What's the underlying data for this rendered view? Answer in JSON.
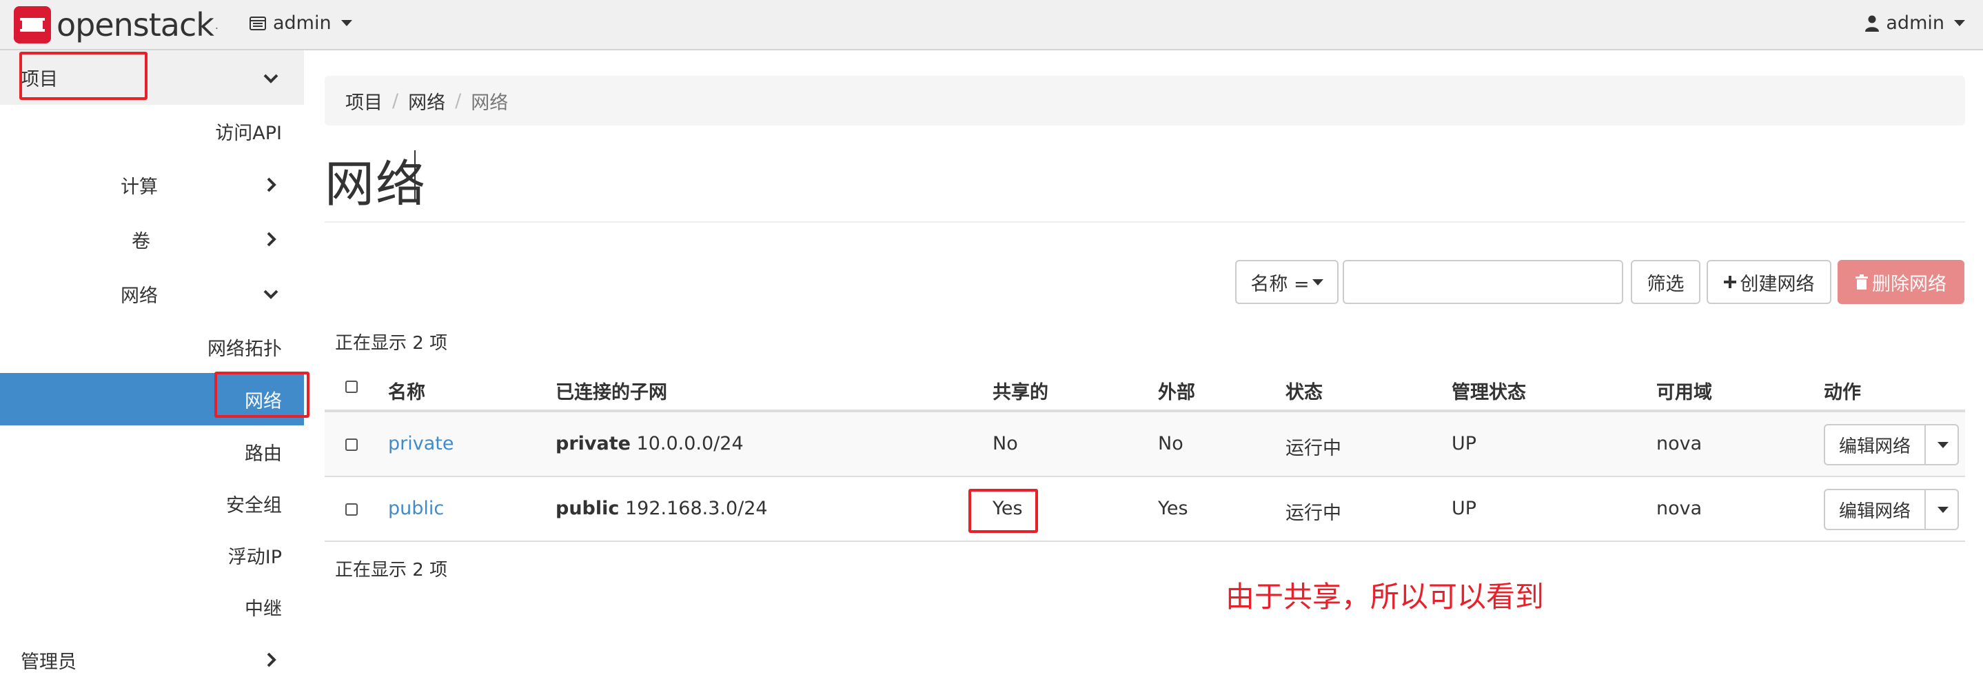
{
  "navbar": {
    "brand": "openstack",
    "brand_mark": ".",
    "project_selector": "admin",
    "user_menu": "admin",
    "colors": {
      "brand_red": "#da1a32",
      "navbar_bg": "#f0f0f0"
    }
  },
  "sidebar": {
    "items": [
      {
        "label": "项目",
        "icon": "chevron-down-icon"
      },
      {
        "label": "访问API"
      },
      {
        "label": "计算",
        "icon": "chevron-right-icon"
      },
      {
        "label": "卷",
        "icon": "chevron-right-icon"
      },
      {
        "label": "网络",
        "icon": "chevron-down-icon"
      },
      {
        "label": "网络拓扑"
      },
      {
        "label": "网络",
        "active": true
      },
      {
        "label": "路由"
      },
      {
        "label": "安全组"
      },
      {
        "label": "浮动IP"
      },
      {
        "label": "中继"
      },
      {
        "label": "管理员",
        "icon": "chevron-right-icon"
      }
    ],
    "active_color": "#428bca"
  },
  "breadcrumb": {
    "items": [
      "项目",
      "网络",
      "网络"
    ],
    "separator": "/"
  },
  "page": {
    "title": "网络"
  },
  "toolbar": {
    "filter_field": "名称 =",
    "search_value": "",
    "filter_button": "筛选",
    "create_button": "创建网络",
    "delete_button": "删除网络"
  },
  "table": {
    "count_top": "正在显示 2 项",
    "count_bottom": "正在显示 2 项",
    "columns": [
      "名称",
      "已连接的子网",
      "共享的",
      "外部",
      "状态",
      "管理状态",
      "可用域",
      "动作"
    ],
    "rows": [
      {
        "name": "private",
        "subnet_name": "private",
        "subnet_cidr": "10.0.0.0/24",
        "shared": "No",
        "external": "No",
        "status": "运行中",
        "admin_state": "UP",
        "zone": "nova",
        "action": "编辑网络"
      },
      {
        "name": "public",
        "subnet_name": "public",
        "subnet_cidr": "192.168.3.0/24",
        "shared": "Yes",
        "external": "Yes",
        "status": "运行中",
        "admin_state": "UP",
        "zone": "nova",
        "action": "编辑网络"
      }
    ]
  },
  "annotation": {
    "note": "由于共享，所以可以看到",
    "color": "#e8202a"
  }
}
